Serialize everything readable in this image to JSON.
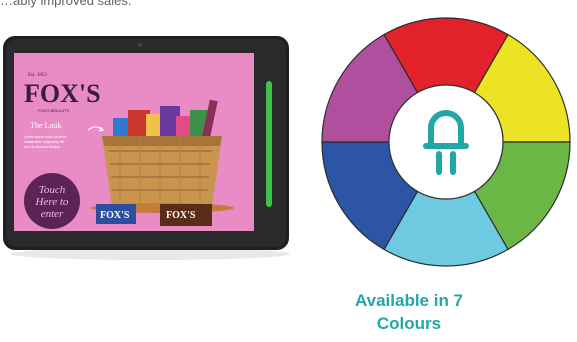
{
  "page": {
    "top_caption": "…ably improved sales."
  },
  "tablet": {
    "brand_logo": "FOX'S",
    "brand_small": "Est. 1853",
    "brand_sub": "FOX'S BISCUITS",
    "screen_heading": "The Look",
    "screen_body_1": "Lorem ipsum dolor sit amet",
    "screen_body_2": "consectetur adipiscing elit",
    "screen_body_3": "sed do eiusmod tempor",
    "cta_line_1": "Touch",
    "cta_line_2": "Here to",
    "cta_line_3": "enter",
    "pack_label_1": "FOX'S",
    "pack_label_2": "FOX'S",
    "background_color": "#e98bc4",
    "led_color": "#3cc34a"
  },
  "led_wheel": {
    "segment_colors": [
      "#e1222a",
      "#ece325",
      "#6bb745",
      "#6ecae0",
      "#2d55a5",
      "#b04f9e"
    ],
    "center_icon": "led-bulb-icon",
    "icon_color": "#21a8a6"
  },
  "caption": {
    "line_1": "Available in 7",
    "line_2": "Colours",
    "color": "#22a7a6"
  }
}
